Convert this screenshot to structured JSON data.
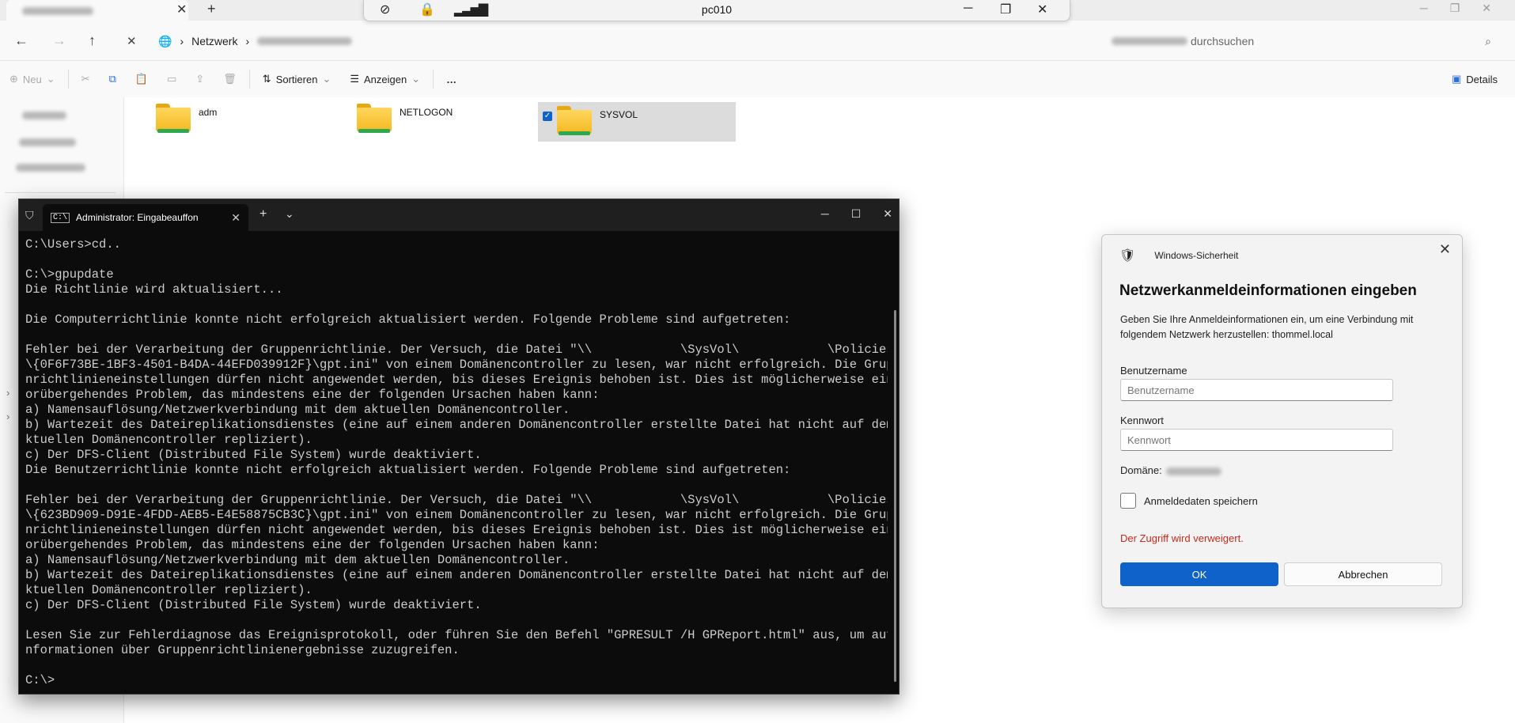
{
  "explorer": {
    "address": {
      "root": "Netzwerk"
    },
    "search": {
      "suffix": "durchsuchen"
    },
    "toolbar": {
      "new": "Neu",
      "sort": "Sortieren",
      "view": "Anzeigen",
      "more": "…",
      "details": "Details"
    },
    "folders": [
      {
        "name": "adm",
        "selected": false
      },
      {
        "name": "NETLOGON",
        "selected": false
      },
      {
        "name": "SYSVOL",
        "selected": true
      }
    ]
  },
  "connection_bar": {
    "host": "pc010"
  },
  "terminal": {
    "tab_title": "Administrator: Eingabeauffon",
    "lines": [
      "C:\\Users>cd..",
      "",
      "C:\\>gpupdate",
      "Die Richtlinie wird aktualisiert...",
      "",
      "Die Computerrichtlinie konnte nicht erfolgreich aktualisiert werden. Folgende Probleme sind aufgetreten:",
      "",
      "Fehler bei der Verarbeitung der Gruppenrichtlinie. Der Versuch, die Datei \"\\\\            \\SysVol\\            \\Policies",
      "\\{0F6F73BE-1BF3-4501-B4DA-44EFD039912F}\\gpt.ini\" von einem Domänencontroller zu lesen, war nicht erfolgreich. Die Gruppe",
      "nrichtlinieneinstellungen dürfen nicht angewendet werden, bis dieses Ereignis behoben ist. Dies ist möglicherweise ein v",
      "orübergehendes Problem, das mindestens eine der folgenden Ursachen haben kann:",
      "a) Namensauflösung/Netzwerkverbindung mit dem aktuellen Domänencontroller.",
      "b) Wartezeit des Dateireplikationsdienstes (eine auf einem anderen Domänencontroller erstellte Datei hat nicht auf dem a",
      "ktuellen Domänencontroller repliziert).",
      "c) Der DFS-Client (Distributed File System) wurde deaktiviert.",
      "Die Benutzerrichtlinie konnte nicht erfolgreich aktualisiert werden. Folgende Probleme sind aufgetreten:",
      "",
      "Fehler bei der Verarbeitung der Gruppenrichtlinie. Der Versuch, die Datei \"\\\\            \\SysVol\\            \\Policies",
      "\\{623BD909-D91E-4FDD-AEB5-E4E58875CB3C}\\gpt.ini\" von einem Domänencontroller zu lesen, war nicht erfolgreich. Die Gruppe",
      "nrichtlinieneinstellungen dürfen nicht angewendet werden, bis dieses Ereignis behoben ist. Dies ist möglicherweise ein v",
      "orübergehendes Problem, das mindestens eine der folgenden Ursachen haben kann:",
      "a) Namensauflösung/Netzwerkverbindung mit dem aktuellen Domänencontroller.",
      "b) Wartezeit des Dateireplikationsdienstes (eine auf einem anderen Domänencontroller erstellte Datei hat nicht auf dem a",
      "ktuellen Domänencontroller repliziert).",
      "c) Der DFS-Client (Distributed File System) wurde deaktiviert.",
      "",
      "Lesen Sie zur Fehlerdiagnose das Ereignisprotokoll, oder führen Sie den Befehl \"GPRESULT /H GPReport.html\" aus, um auf I",
      "nformationen über Gruppenrichtlinienergebnisse zuzugreifen.",
      "",
      "C:\\>"
    ]
  },
  "dialog": {
    "app": "Windows-Sicherheit",
    "title": "Netzwerkanmeldeinformationen eingeben",
    "description": "Geben Sie Ihre Anmeldeinformationen ein, um eine Verbindung mit folgendem Netzwerk herzustellen: thommel.local",
    "username_label": "Benutzername",
    "username_placeholder": "Benutzername",
    "password_label": "Kennwort",
    "password_placeholder": "Kennwort",
    "domain_label": "Domäne:",
    "remember_label": "Anmeldedaten speichern",
    "error": "Der Zugriff wird verweigert.",
    "ok": "OK",
    "cancel": "Abbrechen"
  },
  "colors": {
    "accent": "#0f62c9",
    "error": "#c42b1c",
    "terminal_bg": "#0c0c0c"
  }
}
